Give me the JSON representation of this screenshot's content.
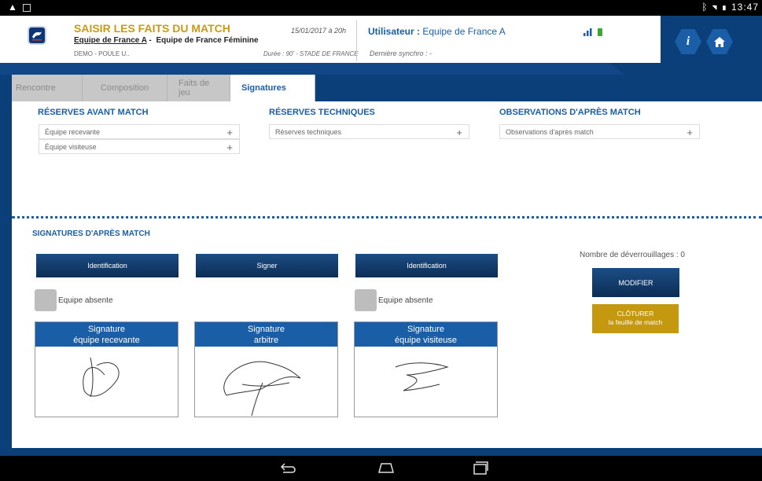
{
  "statusbar": {
    "time": "13:47",
    "warning_icon": "warning-icon",
    "image_icon": "image-icon"
  },
  "header": {
    "title": "SAISIR LES FAITS DU MATCH",
    "team_home": "Equipe de France A",
    "team_separator": " - ",
    "team_away": "Equipe de France Féminine",
    "poule": "DEMO - POULE U..",
    "date": "15/01/2017 à 20h",
    "duree": "Durée : 90' - STADE DE FRANCE",
    "user_label": "Utilisateur :",
    "user_value": " Equipe de France A",
    "synchro": "Dernière synchro : -",
    "info_label": "i"
  },
  "tabs": [
    {
      "label": "Rencontre",
      "active": false
    },
    {
      "label": "Composition",
      "active": false
    },
    {
      "label": "Faits de jeu",
      "active": false
    },
    {
      "label": "Signatures",
      "active": true
    }
  ],
  "reserves": {
    "avant_match": {
      "title": "RÉSERVES AVANT MATCH",
      "fields": [
        "Équipe recevante",
        "Équipe visiteuse"
      ]
    },
    "techniques": {
      "title": "RÉSERVES TECHNIQUES",
      "fields": [
        "Réserves techniques"
      ]
    },
    "observations": {
      "title": "OBSERVATIONS D'APRÈS MATCH",
      "fields": [
        "Observations d'après match"
      ]
    },
    "plus": "+"
  },
  "signatures": {
    "title": "SIGNATURES D'APRÈS MATCH",
    "btn_identification_home": "Identification",
    "btn_signer": "Signer",
    "btn_identification_away": "Identification",
    "absent_home": "Equipe absente",
    "absent_away": "Equipe absente",
    "box_home_line1": "Signature",
    "box_home_line2": "équipe recevante",
    "box_ref_line1": "Signature",
    "box_ref_line2": "arbitre",
    "box_away_line1": "Signature",
    "box_away_line2": "équipe visiteuse",
    "unlock_count": "Nombre de déverrouillages : 0",
    "btn_modifier": "MODIFIER",
    "btn_cloturer_line1": "CLÔTURER",
    "btn_cloturer_line2": "la feuille de match"
  },
  "colors": {
    "primary": "#1a5ea8",
    "dark_blue": "#0b3f7a",
    "gold": "#c4980f",
    "title_gold": "#c99a13"
  }
}
